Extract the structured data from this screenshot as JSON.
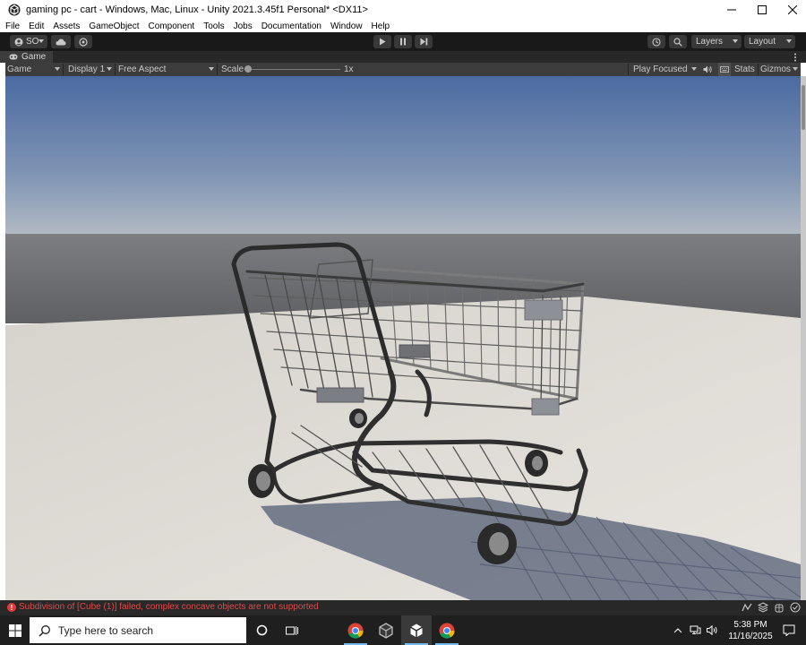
{
  "window": {
    "title": "gaming pc - cart - Windows, Mac, Linux - Unity 2021.3.45f1 Personal* <DX11>"
  },
  "menu": {
    "items": [
      "File",
      "Edit",
      "Assets",
      "GameObject",
      "Component",
      "Tools",
      "Jobs",
      "Documentation",
      "Window",
      "Help"
    ]
  },
  "toolbar": {
    "account_label": "SO",
    "layers_label": "Layers",
    "layout_label": "Layout"
  },
  "game_tab": {
    "label": "Game"
  },
  "game_view": {
    "mode_label": "Game",
    "display_label": "Display 1",
    "aspect_label": "Free Aspect",
    "scale_label": "Scale",
    "scale_value": "1x",
    "play_mode_label": "Play Focused",
    "stats_label": "Stats",
    "gizmos_label": "Gizmos"
  },
  "console": {
    "error_message": "Subdivision of [Cube (1)] failed, complex concave objects are not supported"
  },
  "taskbar": {
    "search_placeholder": "Type here to search",
    "time": "5:38 PM",
    "date": "11/16/2025"
  },
  "colors": {
    "unity_dark": "#191919",
    "unity_panel": "#3c3c3c",
    "error_red": "#e04848",
    "sky_top": "#4a6aa0",
    "ground": "#dedad5"
  }
}
